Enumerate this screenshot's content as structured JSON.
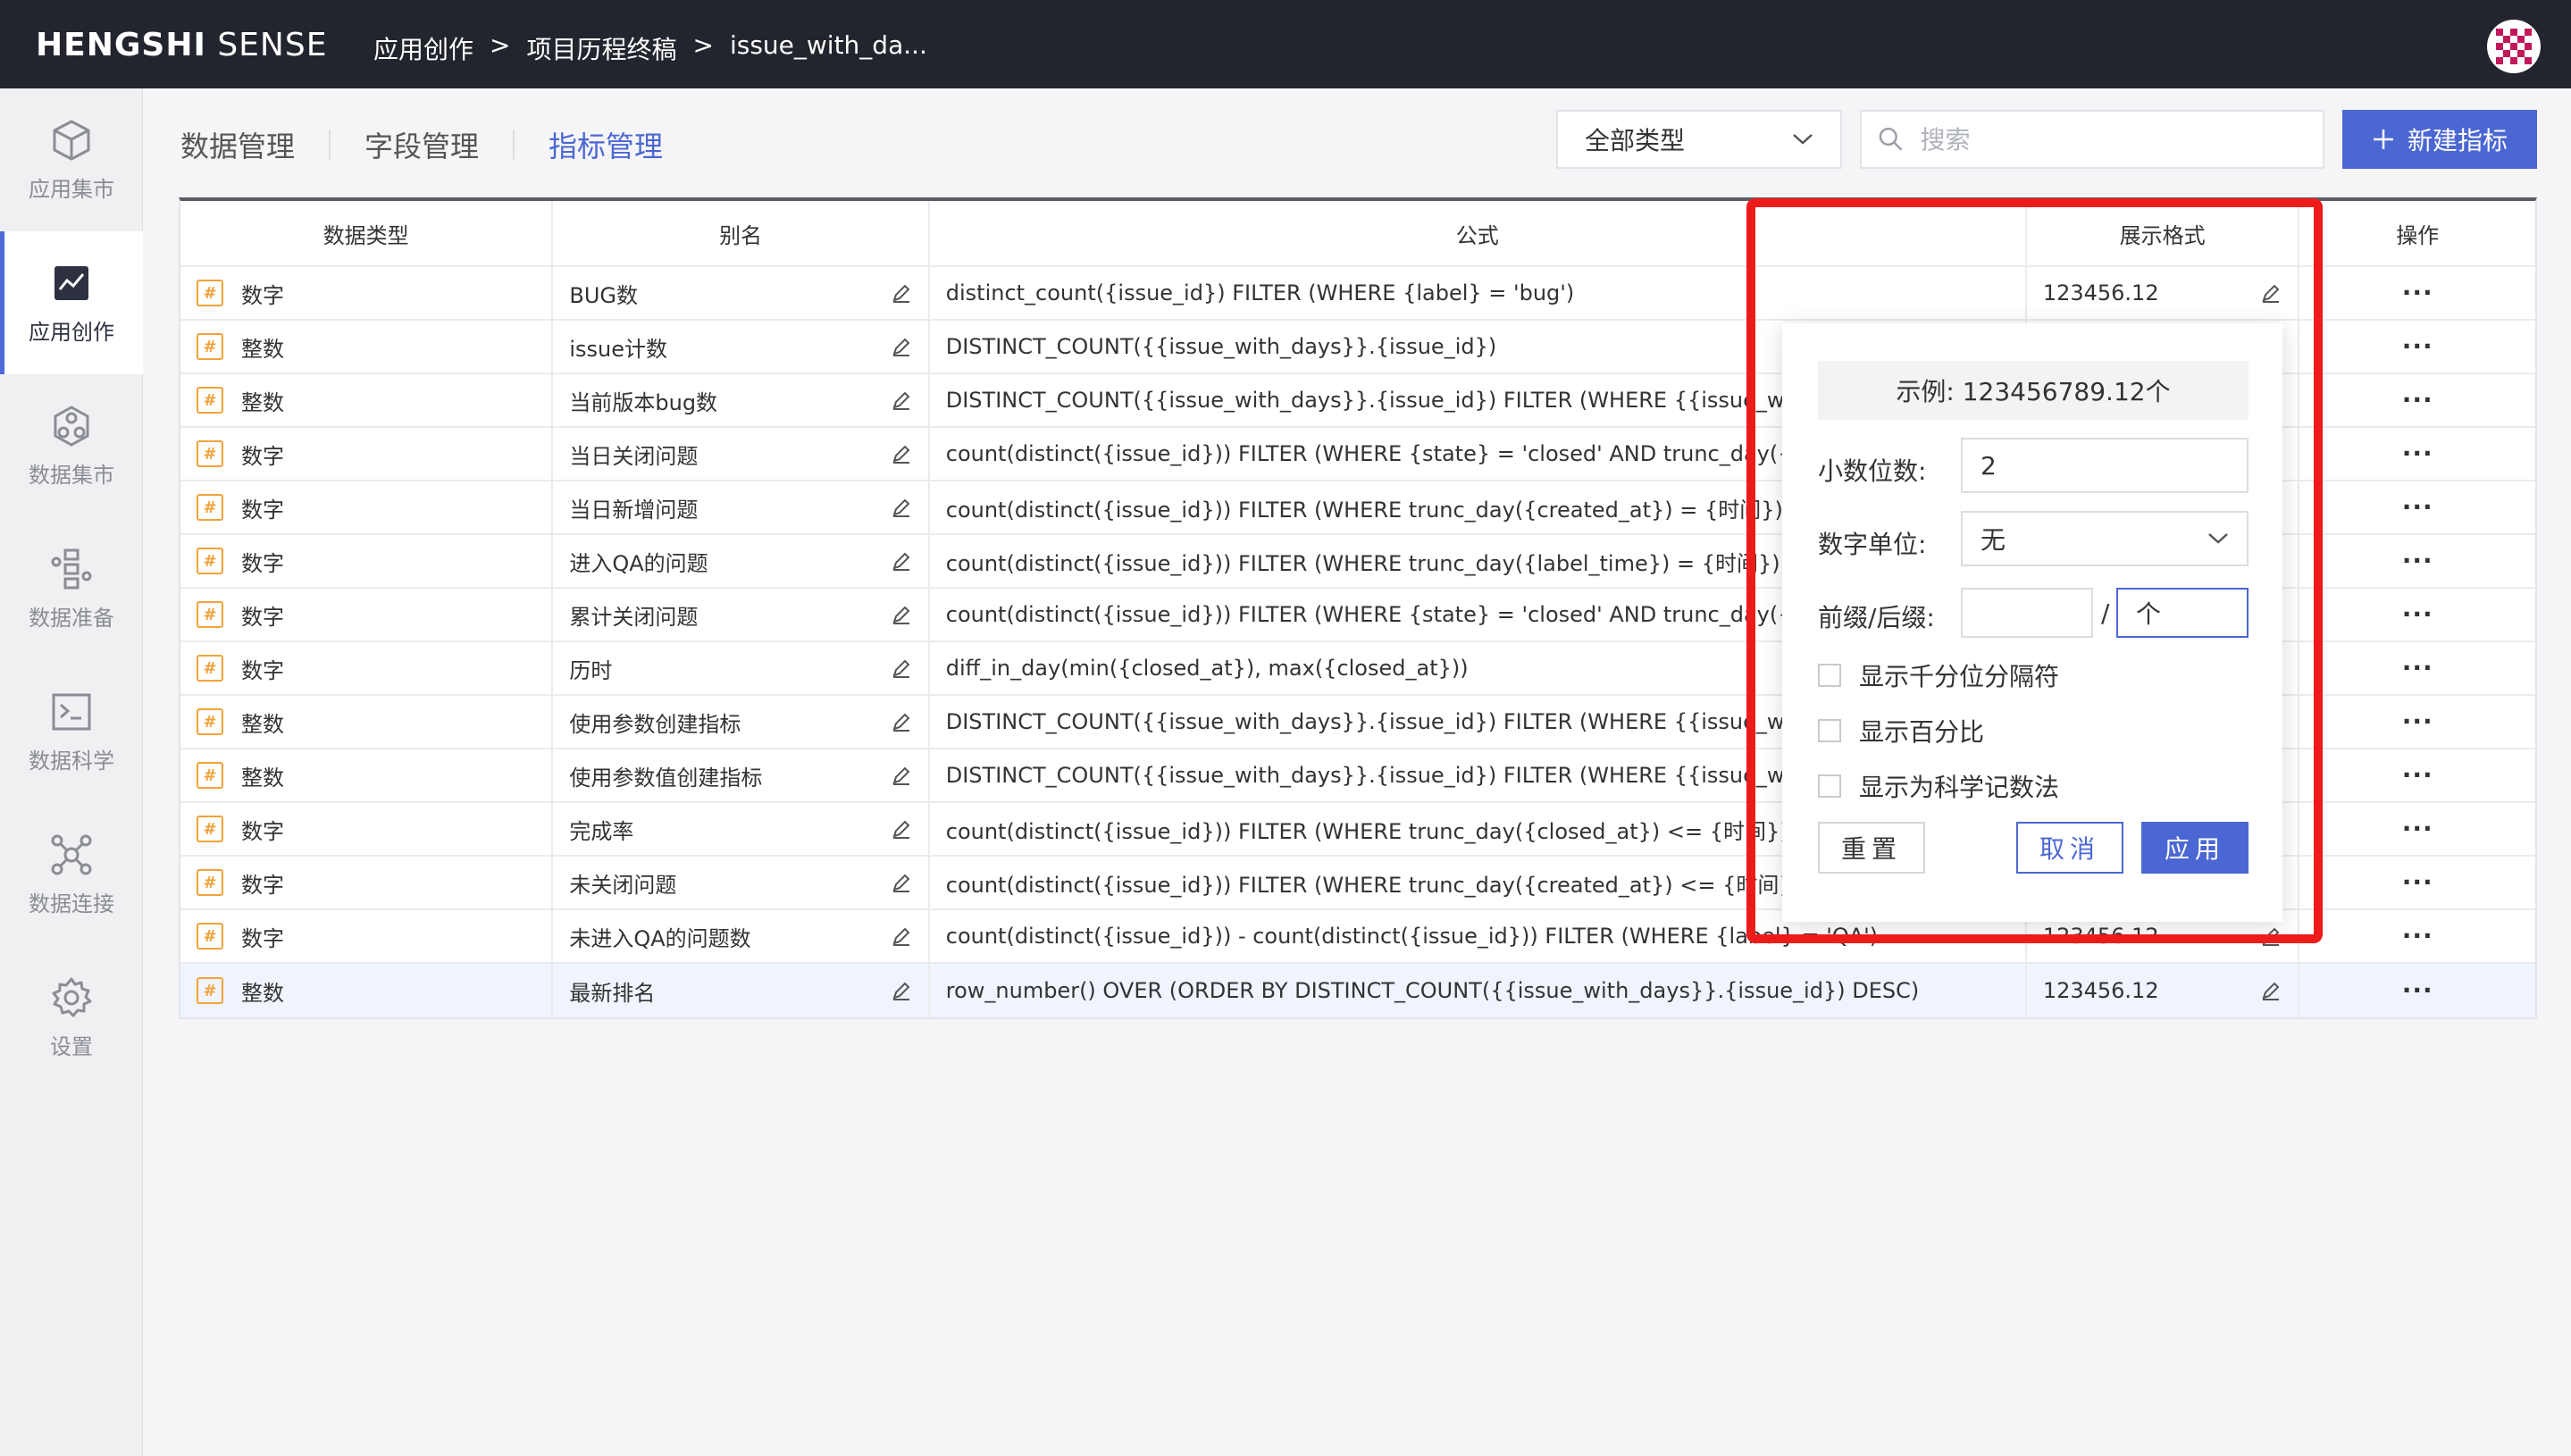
{
  "topbar": {
    "logo_bold": "HENGSHI",
    "logo_light": "SENSE",
    "breadcrumb": [
      "应用创作",
      "项目历程终稿",
      "issue_with_da..."
    ],
    "breadcrumb_sep": ">"
  },
  "sidebar": {
    "items": [
      {
        "label": "应用集市",
        "icon": "cube-icon"
      },
      {
        "label": "应用创作",
        "icon": "chart-edit-icon",
        "active": true
      },
      {
        "label": "数据集市",
        "icon": "hexagon-nodes-icon"
      },
      {
        "label": "数据准备",
        "icon": "flow-icon"
      },
      {
        "label": "数据科学",
        "icon": "terminal-icon"
      },
      {
        "label": "数据连接",
        "icon": "network-icon"
      },
      {
        "label": "设置",
        "icon": "gear-icon"
      }
    ]
  },
  "tabs": [
    {
      "label": "数据管理"
    },
    {
      "label": "字段管理"
    },
    {
      "label": "指标管理",
      "active": true
    }
  ],
  "toolbar": {
    "type_select": "全部类型",
    "search_placeholder": "搜索",
    "new_button": "新建指标"
  },
  "table": {
    "headers": [
      "数据类型",
      "别名",
      "公式",
      "展示格式",
      "操作"
    ],
    "rows": [
      {
        "type": "数字",
        "alias": "BUG数",
        "formula": "distinct_count({issue_id}) FILTER (WHERE {label} = 'bug')",
        "format": "123456.12"
      },
      {
        "type": "整数",
        "alias": "issue计数",
        "formula": "DISTINCT_COUNT({{issue_with_days}}.{issue_id})",
        "format": ""
      },
      {
        "type": "整数",
        "alias": "当前版本bug数",
        "formula": "DISTINCT_COUNT({{issue_with_days}}.{issue_id}) FILTER (WHERE {{issue_with_days",
        "format": ""
      },
      {
        "type": "数字",
        "alias": "当日关闭问题",
        "formula": "count(distinct({issue_id})) FILTER (WHERE {state} = 'closed' AND trunc_day({close",
        "format": ""
      },
      {
        "type": "数字",
        "alias": "当日新增问题",
        "formula": "count(distinct({issue_id})) FILTER (WHERE trunc_day({created_at}) = {时间})",
        "format": ""
      },
      {
        "type": "数字",
        "alias": "进入QA的问题",
        "formula": "count(distinct({issue_id})) FILTER (WHERE trunc_day({label_time}) = {时间})",
        "format": ""
      },
      {
        "type": "数字",
        "alias": "累计关闭问题",
        "formula": "count(distinct({issue_id})) FILTER (WHERE {state} = 'closed' AND trunc_day({close",
        "format": ""
      },
      {
        "type": "数字",
        "alias": "历时",
        "formula": "diff_in_day(min({closed_at}), max({closed_at}))",
        "format": ""
      },
      {
        "type": "整数",
        "alias": "使用参数创建指标",
        "formula": "DISTINCT_COUNT({{issue_with_days}}.{issue_id}) FILTER (WHERE {{issue_with_days",
        "format": ""
      },
      {
        "type": "整数",
        "alias": "使用参数值创建指标",
        "formula": "DISTINCT_COUNT({{issue_with_days}}.{issue_id}) FILTER (WHERE {{issue_with_days",
        "format": ""
      },
      {
        "type": "数字",
        "alias": "完成率",
        "formula": "count(distinct({issue_id})) FILTER (WHERE trunc_day({closed_at}) <= {时间}) / coun",
        "format": ""
      },
      {
        "type": "数字",
        "alias": "未关闭问题",
        "formula": "count(distinct({issue_id})) FILTER (WHERE trunc_day({created_at}) <= {时间} AND tr",
        "format": ""
      },
      {
        "type": "数字",
        "alias": "未进入QA的问题数",
        "formula": "count(distinct({issue_id})) - count(distinct({issue_id})) FILTER (WHERE {label} = 'QA')",
        "format": "123456.12"
      },
      {
        "type": "整数",
        "alias": "最新排名",
        "formula": "row_number() OVER (ORDER BY DISTINCT_COUNT({{issue_with_days}}.{issue_id}) DESC)",
        "format": "123456.12",
        "highlight": true
      }
    ]
  },
  "popup": {
    "example": "示例: 123456789.12个",
    "decimal_label": "小数位数:",
    "decimal_value": "2",
    "unit_label": "数字单位:",
    "unit_value": "无",
    "affix_label": "前缀/后缀:",
    "prefix_value": "",
    "affix_sep": "/",
    "suffix_value": "个",
    "checks": [
      "显示千分位分隔符",
      "显示百分比",
      "显示为科学记数法"
    ],
    "reset": "重置",
    "cancel": "取消",
    "apply": "应用"
  },
  "colors": {
    "accent": "#4b67d3",
    "topbar": "#23252e",
    "highlight_box": "#ee1b1b",
    "type_icon": "#f2a23b"
  }
}
